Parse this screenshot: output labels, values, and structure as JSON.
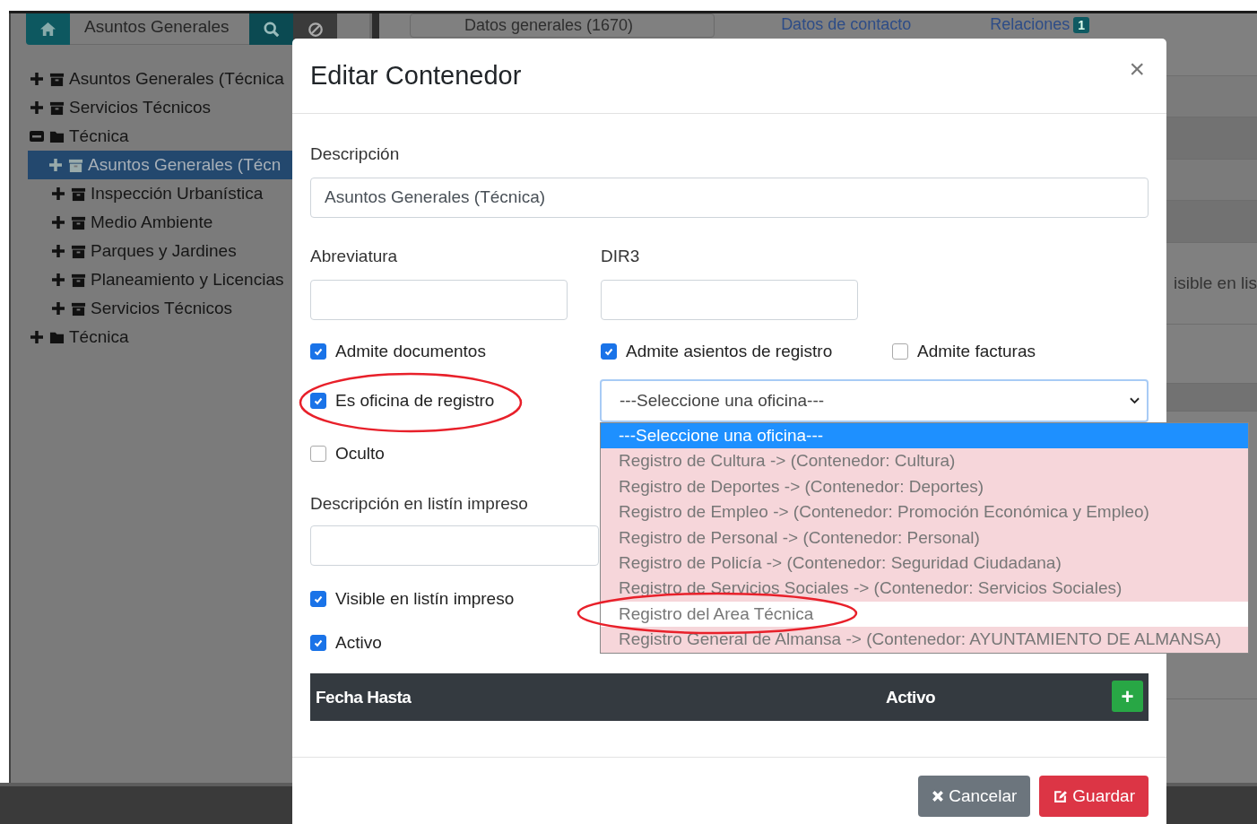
{
  "sidebar": {
    "search": {
      "value": "Asuntos Generales"
    },
    "tree": [
      {
        "label": "Asuntos Generales (Técnica",
        "kind": "archive",
        "expanded": false,
        "selected": false
      },
      {
        "label": "Servicios Técnicos",
        "kind": "archive",
        "expanded": false,
        "selected": false
      },
      {
        "label": "Técnica",
        "kind": "folder",
        "expanded": true,
        "selected": false,
        "children": [
          {
            "label": "Asuntos Generales (Técn",
            "kind": "archive",
            "expanded": false,
            "selected": true
          },
          {
            "label": "Inspección Urbanística",
            "kind": "archive",
            "expanded": false,
            "selected": false
          },
          {
            "label": "Medio Ambiente",
            "kind": "archive",
            "expanded": false,
            "selected": false
          },
          {
            "label": "Parques y Jardines",
            "kind": "archive",
            "expanded": false,
            "selected": false
          },
          {
            "label": "Planeamiento y Licencias",
            "kind": "archive",
            "expanded": false,
            "selected": false
          },
          {
            "label": "Servicios Técnicos",
            "kind": "archive",
            "expanded": false,
            "selected": false
          }
        ]
      },
      {
        "label": "Técnica",
        "kind": "folder",
        "expanded": false,
        "selected": false
      }
    ]
  },
  "tabs": [
    {
      "label": "Datos generales (1670)",
      "selected": true
    },
    {
      "label": "Datos de contacto",
      "selected": false
    },
    {
      "label": "Relaciones",
      "selected": false,
      "badge": "1"
    }
  ],
  "background_texts": [
    "isible en lis"
  ],
  "modal": {
    "title": "Editar Contenedor",
    "close": "×",
    "descripcion": {
      "label": "Descripción",
      "value": "Asuntos Generales (Técnica)"
    },
    "abreviatura": {
      "label": "Abreviatura"
    },
    "dir3": {
      "label": "DIR3"
    },
    "flags_row": [
      {
        "label": "Admite documentos",
        "checked": true
      },
      {
        "label": "Admite asientos de registro",
        "checked": true
      },
      {
        "label": "Admite facturas",
        "checked": false
      }
    ],
    "oficina": {
      "label": "Es oficina de registro",
      "checked": true,
      "circled": true
    },
    "select": {
      "value": "---Seleccione una oficina---",
      "open": true,
      "options": [
        {
          "label": "---Seleccione una oficina---",
          "selected": true,
          "flagged": false,
          "circled": false
        },
        {
          "label": "Registro de Cultura -> (Contenedor: Cultura)",
          "selected": false,
          "flagged": true,
          "circled": false
        },
        {
          "label": "Registro de Deportes -> (Contenedor: Deportes)",
          "selected": false,
          "flagged": true,
          "circled": false
        },
        {
          "label": "Registro de Empleo -> (Contenedor: Promoción Económica y Empleo)",
          "selected": false,
          "flagged": true,
          "circled": false
        },
        {
          "label": "Registro de Personal -> (Contenedor: Personal)",
          "selected": false,
          "flagged": true,
          "circled": false
        },
        {
          "label": "Registro de Policía -> (Contenedor: Seguridad Ciudadana)",
          "selected": false,
          "flagged": true,
          "circled": false
        },
        {
          "label": "Registro de Servicios Sociales -> (Contenedor: Servicios Sociales)",
          "selected": false,
          "flagged": true,
          "circled": false
        },
        {
          "label": "Registro del Area Técnica",
          "selected": false,
          "flagged": false,
          "circled": true
        },
        {
          "label": "Registro General de Almansa -> (Contenedor: AYUNTAMIENTO DE ALMANSA)",
          "selected": false,
          "flagged": true,
          "circled": false
        }
      ]
    },
    "oculto": {
      "label": "Oculto",
      "checked": false
    },
    "listin": {
      "label": "Descripción en listín impreso"
    },
    "visible": {
      "label": "Visible en listín impreso",
      "checked": true
    },
    "activo": {
      "label": "Activo",
      "checked": true
    },
    "table": {
      "columns": [
        "Fecha Hasta",
        "Activo"
      ],
      "add_button": "+"
    },
    "buttons": [
      {
        "label": "Cancelar",
        "kind": "cancel"
      },
      {
        "label": "Guardar",
        "kind": "save"
      }
    ]
  }
}
